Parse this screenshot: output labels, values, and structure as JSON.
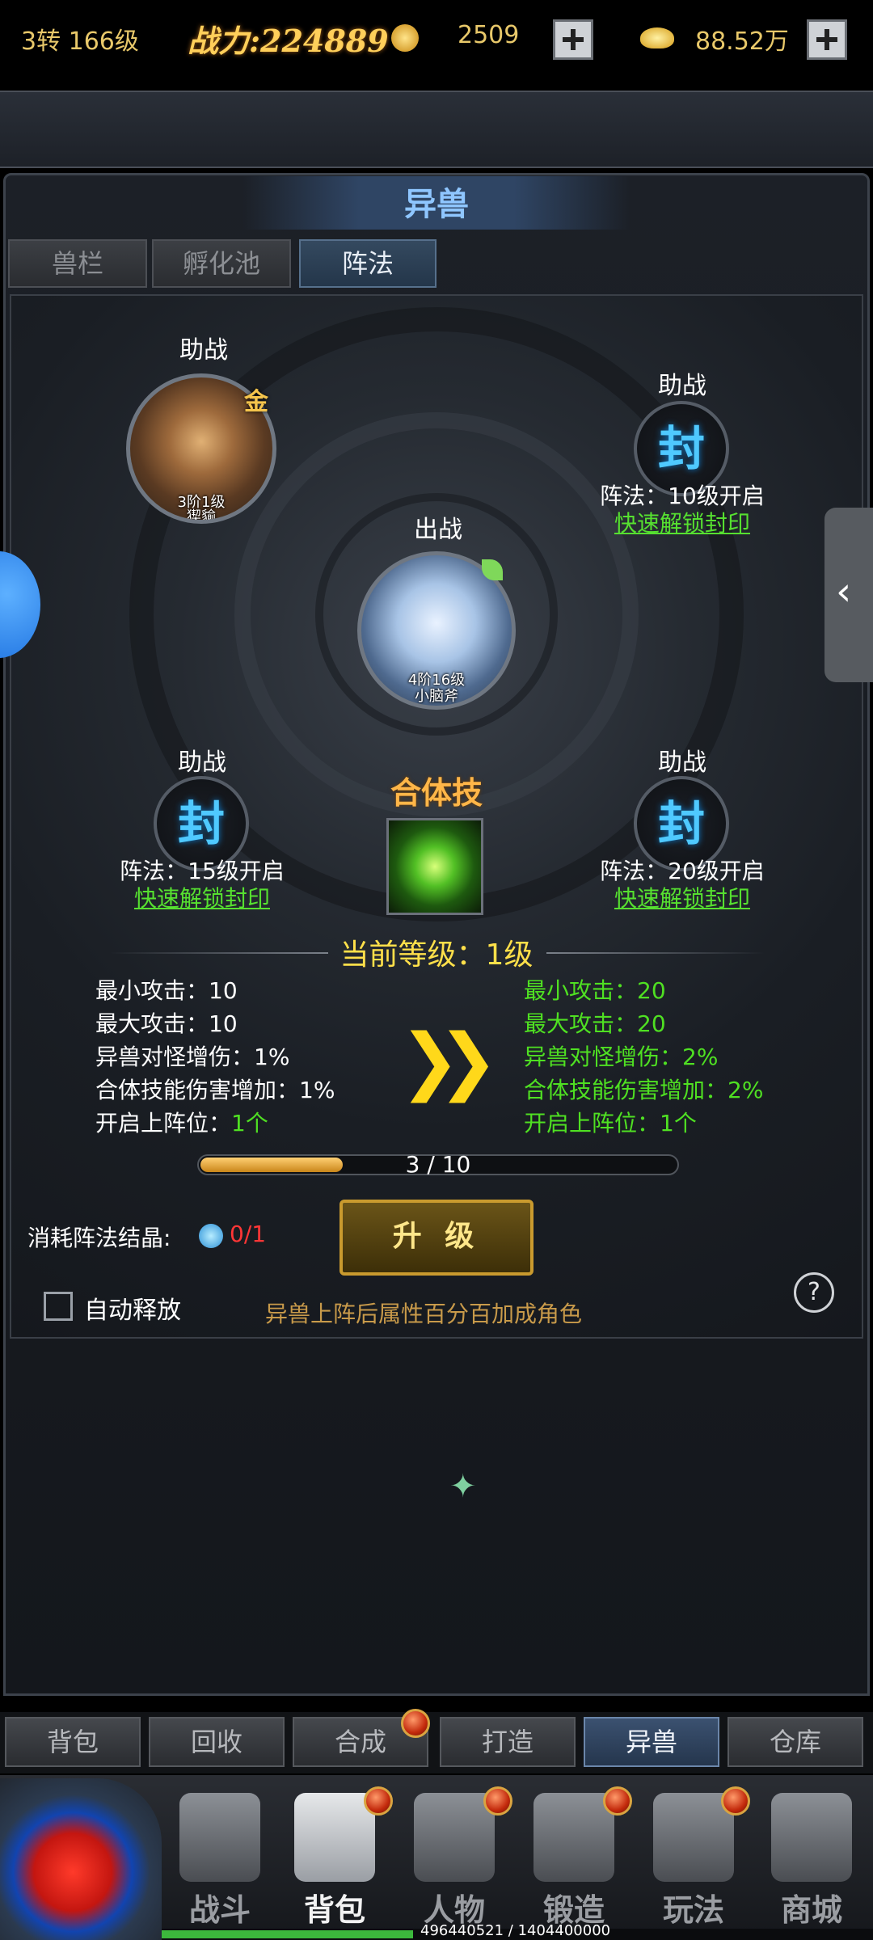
{
  "status": {
    "level": "3转 166级",
    "power": "战力:224889",
    "coin_value": "2509",
    "ingot_value": "88.52万"
  },
  "panel": {
    "title": "异兽",
    "tabs": [
      "兽栏",
      "孵化池",
      "阵法"
    ],
    "active_tab": 2
  },
  "formation": {
    "top_left": {
      "label": "助战",
      "pet_info": "3阶1级",
      "pet_name": "猰貐",
      "grade": "金"
    },
    "center": {
      "label": "出战",
      "pet_info": "4阶16级",
      "pet_name": "小脑斧"
    },
    "top_right": {
      "label": "助战",
      "seal": "封",
      "requirement": "阵法：10级开启",
      "unlock": "快速解锁封印"
    },
    "bottom_left": {
      "label": "助战",
      "seal": "封",
      "requirement": "阵法：15级开启",
      "unlock": "快速解锁封印"
    },
    "bottom_right": {
      "label": "助战",
      "seal": "封",
      "requirement": "阵法：20级开启",
      "unlock": "快速解锁封印"
    },
    "combo_title": "合体技"
  },
  "level": {
    "current": "当前等级：1级"
  },
  "stats_current": [
    {
      "label": "最小攻击：",
      "value": "10"
    },
    {
      "label": "最大攻击：",
      "value": "10"
    },
    {
      "label": "异兽对怪增伤：",
      "value": "1%"
    },
    {
      "label": "合体技能伤害增加：",
      "value": "1%"
    },
    {
      "label": "开启上阵位：",
      "value": "1个"
    }
  ],
  "stats_next": [
    {
      "label": "最小攻击：",
      "value": "20"
    },
    {
      "label": "最大攻击：",
      "value": "20"
    },
    {
      "label": "异兽对怪增伤：",
      "value": "2%"
    },
    {
      "label": "合体技能伤害增加：",
      "value": "2%"
    },
    {
      "label": "开启上阵位：",
      "value": "1个"
    }
  ],
  "progress": {
    "text": "3 / 10",
    "fraction": 0.3
  },
  "consume": {
    "label": "消耗阵法结晶:",
    "value": "0/1"
  },
  "upgrade_label": "升 级",
  "auto_release_label": "自动释放",
  "footer_note": "异兽上阵后属性百分百加成角色",
  "help_label": "?",
  "bottom_tabs": [
    "背包",
    "回收",
    "合成",
    "打造",
    "异兽",
    "仓库"
  ],
  "bottom_tab_active": 4,
  "nav": [
    {
      "label": "战斗",
      "icon": "crossed-swords-icon"
    },
    {
      "label": "背包",
      "icon": "backpack-icon"
    },
    {
      "label": "人物",
      "icon": "character-icon"
    },
    {
      "label": "锻造",
      "icon": "anvil-icon"
    },
    {
      "label": "玩法",
      "icon": "winged-sword-icon"
    },
    {
      "label": "商城",
      "icon": "shop-gate-icon"
    }
  ],
  "exp": {
    "text": "496440521 / 1404400000",
    "fraction": 0.353
  },
  "colors": {
    "accent_gold": "#ffcf5a",
    "bonus_green": "#4fe022",
    "seal_blue": "#4fc9ff",
    "warning_red": "#ff3636"
  }
}
